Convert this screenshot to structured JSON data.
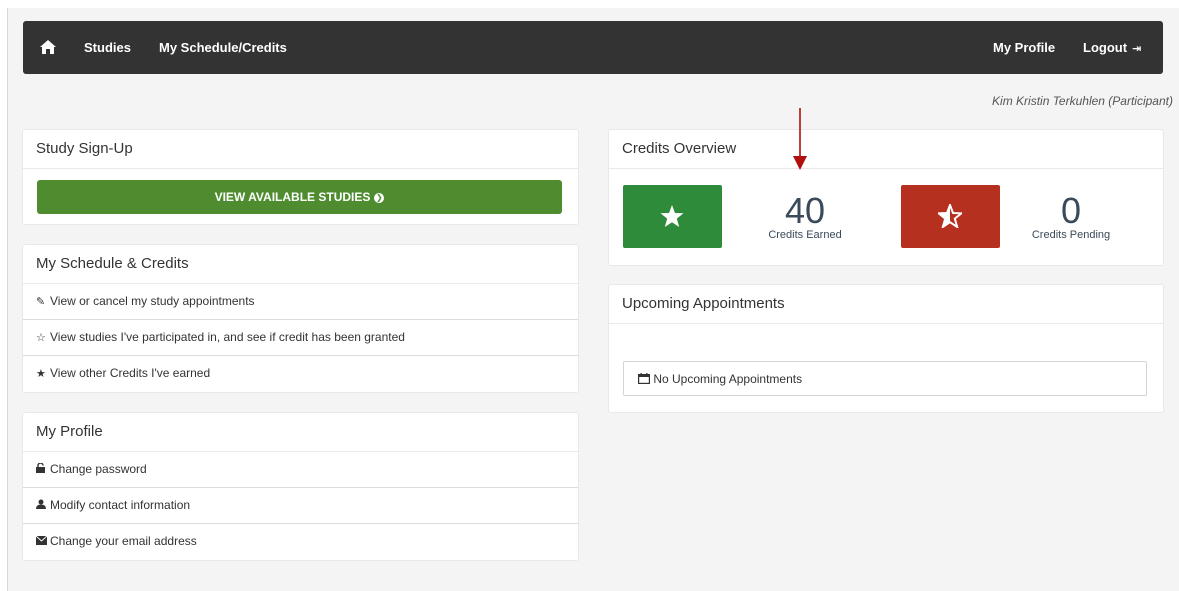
{
  "navbar": {
    "home_icon": "home-icon",
    "studies": "Studies",
    "schedule": "My Schedule/Credits",
    "profile": "My Profile",
    "logout": "Logout",
    "logout_icon": "logout-icon"
  },
  "user": {
    "name": "Kim Kristin Terkuhlen (Participant)"
  },
  "signup": {
    "title": "Study Sign-Up",
    "button_label": "VIEW AVAILABLE STUDIES"
  },
  "schedule": {
    "title": "My Schedule & Credits",
    "items": [
      {
        "icon": "edit-icon",
        "label": "View or cancel my study appointments"
      },
      {
        "icon": "star-half-icon",
        "label": "View studies I've participated in, and see if credit has been granted"
      },
      {
        "icon": "star-icon",
        "label": "View other Credits I've earned"
      }
    ]
  },
  "profile": {
    "title": "My Profile",
    "items": [
      {
        "icon": "unlock-icon",
        "label": "Change password"
      },
      {
        "icon": "user-icon",
        "label": "Modify contact information"
      },
      {
        "icon": "envelope-icon",
        "label": "Change your email address"
      }
    ]
  },
  "credits": {
    "title": "Credits Overview",
    "earned_value": "40",
    "earned_label": "Credits Earned",
    "pending_value": "0",
    "pending_label": "Credits Pending",
    "earned_color": "#2e8b3a",
    "pending_color": "#b5301f"
  },
  "appointments": {
    "title": "Upcoming Appointments",
    "empty_text": "No Upcoming Appointments",
    "empty_icon": "calendar-icon"
  },
  "annotation": {
    "arrow_color": "#b01010"
  }
}
